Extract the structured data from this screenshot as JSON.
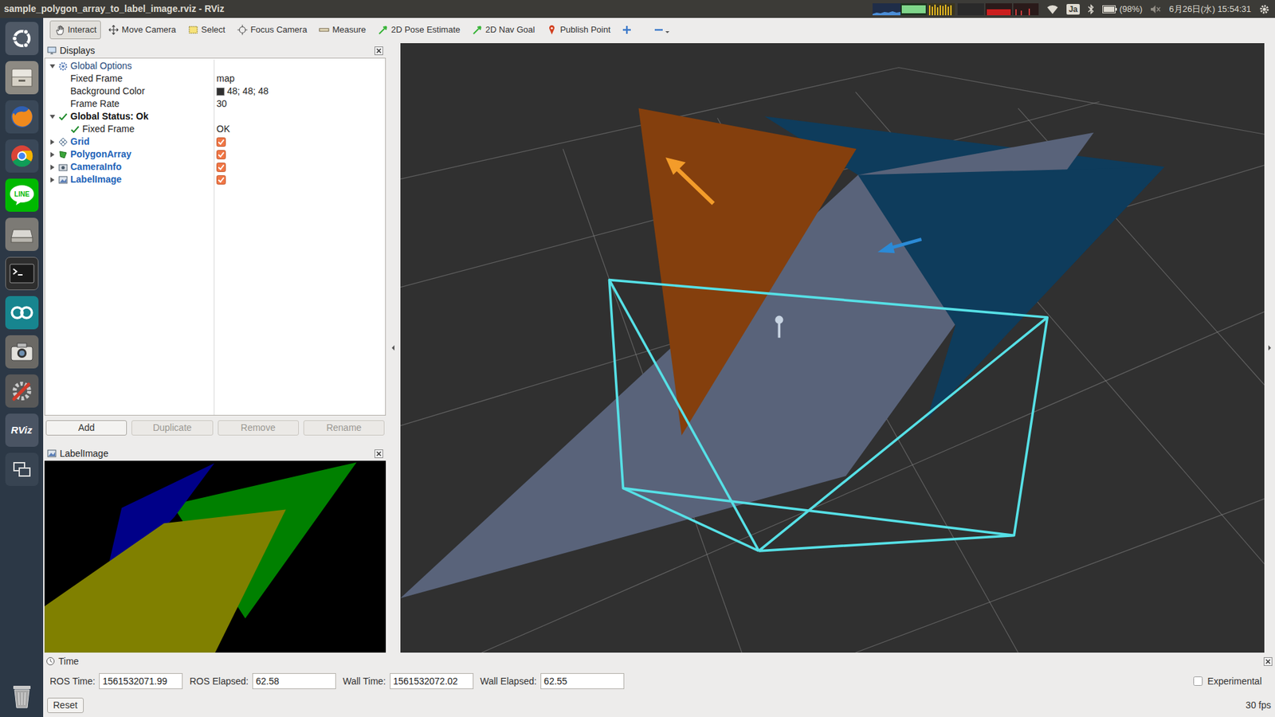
{
  "window": {
    "title": "sample_polygon_array_to_label_image.rviz - RViz"
  },
  "top_panel": {
    "keyboard": "Ja",
    "battery": "(98%)",
    "clock": "6月26日(水) 15:54:31"
  },
  "launcher": {
    "line_label": "LINE",
    "rviz_label": "RViz"
  },
  "toolbar": {
    "tools": [
      {
        "label": "Interact",
        "selected": true
      },
      {
        "label": "Move Camera",
        "selected": false
      },
      {
        "label": "Select",
        "selected": false
      },
      {
        "label": "Focus Camera",
        "selected": false
      },
      {
        "label": "Measure",
        "selected": false
      },
      {
        "label": "2D Pose Estimate",
        "selected": false
      },
      {
        "label": "2D Nav Goal",
        "selected": false
      },
      {
        "label": "Publish Point",
        "selected": false
      }
    ]
  },
  "displays_panel": {
    "title": "Displays",
    "tree": [
      {
        "label": "Global Options",
        "level": 0,
        "kind": "group",
        "expanded": true
      },
      {
        "label": "Fixed Frame",
        "value": "map",
        "level": 1,
        "kind": "property"
      },
      {
        "label": "Background Color",
        "value": "48; 48; 48",
        "level": 1,
        "kind": "color",
        "swatch": "#303030"
      },
      {
        "label": "Frame Rate",
        "value": "30",
        "level": 1,
        "kind": "property"
      },
      {
        "label": "Global Status: Ok",
        "level": 0,
        "kind": "status",
        "expanded": true
      },
      {
        "label": "Fixed Frame",
        "value": "OK",
        "level": 1,
        "kind": "status-item"
      },
      {
        "label": "Grid",
        "level": 0,
        "kind": "display",
        "expanded": false,
        "checked": true
      },
      {
        "label": "PolygonArray",
        "level": 0,
        "kind": "display",
        "expanded": false,
        "checked": true
      },
      {
        "label": "CameraInfo",
        "level": 0,
        "kind": "display",
        "expanded": false,
        "checked": true
      },
      {
        "label": "LabelImage",
        "level": 0,
        "kind": "display",
        "expanded": false,
        "checked": true
      }
    ],
    "buttons": [
      {
        "label": "Add",
        "disabled": false
      },
      {
        "label": "Duplicate",
        "disabled": true
      },
      {
        "label": "Remove",
        "disabled": true
      },
      {
        "label": "Rename",
        "disabled": true
      }
    ]
  },
  "label_image_panel": {
    "title": "LabelImage"
  },
  "time_panel": {
    "title": "Time",
    "fields": [
      {
        "label": "ROS Time:",
        "value": "1561532071.99"
      },
      {
        "label": "ROS Elapsed:",
        "value": "62.58"
      },
      {
        "label": "Wall Time:",
        "value": "1561532072.02"
      },
      {
        "label": "Wall Elapsed:",
        "value": "62.55"
      }
    ],
    "experimental": {
      "label": "Experimental",
      "checked": false
    },
    "reset": "Reset",
    "fps": "30 fps"
  }
}
